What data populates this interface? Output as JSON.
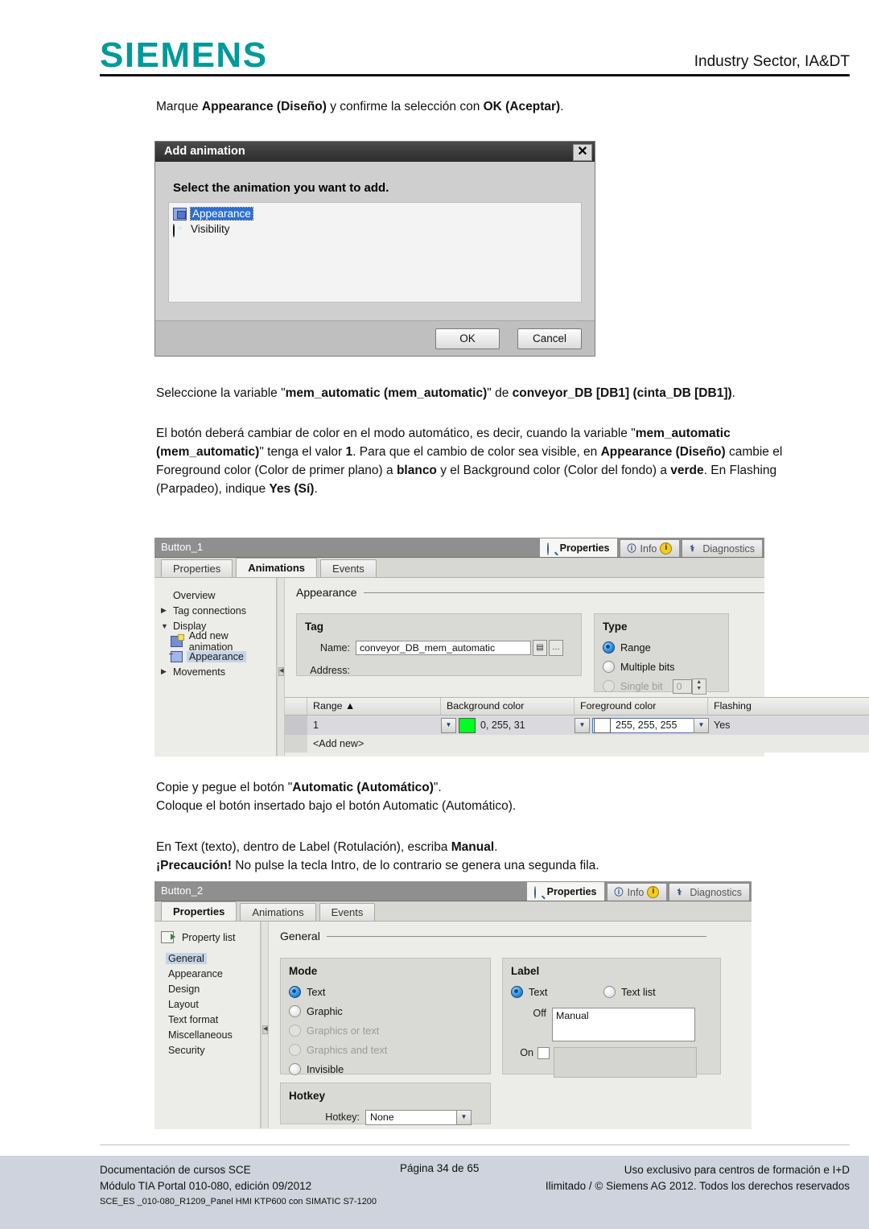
{
  "header": {
    "logo": "SIEMENS",
    "right_text": "Industry Sector, IA&DT"
  },
  "body": {
    "intro_pre": "Marque ",
    "intro_b1": "Appearance (Diseño)",
    "intro_mid": " y confirme la selección con ",
    "intro_b2": "OK (Aceptar)",
    "intro_end": ".",
    "select_pre": "Seleccione la variable \"",
    "select_b1": "mem_automatic (mem_automatic)",
    "select_mid": "\" de ",
    "select_b2": "conveyor_DB [DB1] (cinta_DB [DB1])",
    "select_end": ".",
    "desc_1": "El botón deberá cambiar de color en el modo automático, es decir, cuando la variable \"",
    "desc_b1": "mem_automatic (mem_automatic)",
    "desc_2": "\" tenga el valor ",
    "desc_b2": "1",
    "desc_3": ". Para que el cambio de color sea visible, en ",
    "desc_b3": "Appearance (Diseño)",
    "desc_4": " cambie el Foreground color (Color de primer plano) a ",
    "desc_b4": "blanco",
    "desc_5": " y el Background color (Color del fondo) a ",
    "desc_b5": "verde",
    "desc_6": ". En Flashing (Parpadeo), indique ",
    "desc_b6": "Yes (Sí)",
    "desc_7": ".",
    "copy_pre": "Copie y pegue el botón \"",
    "copy_b1": "Automatic (Automático)",
    "copy_end": "\".",
    "copy_line2": "Coloque el botón insertado bajo el botón Automatic (Automático).",
    "text_pre": "En Text (texto), dentro de Label (Rotulación), escriba ",
    "text_b1": "Manual",
    "text_end": ".",
    "caution_b": "¡Precaución!",
    "caution_rest": " No pulse la tecla Intro, de lo contrario se genera una segunda fila."
  },
  "dialog": {
    "title": "Add animation",
    "close_label": "✕",
    "prompt": "Select the animation you want to add.",
    "items": [
      {
        "label": "Appearance",
        "icon": "appearance-icon",
        "selected": true
      },
      {
        "label": "Visibility",
        "icon": "visibility-icon",
        "selected": false
      }
    ],
    "ok_label": "OK",
    "cancel_label": "Cancel"
  },
  "panel1": {
    "object_name": "Button_1",
    "top_tabs": [
      {
        "label": "Properties",
        "icon": "magnifier-icon",
        "active": true
      },
      {
        "label": "Info",
        "icon": "info-icon",
        "badge": "i",
        "active": false
      },
      {
        "label": "Diagnostics",
        "icon": "diagnostics-icon",
        "active": false
      }
    ],
    "sub_tabs": [
      {
        "label": "Properties",
        "active": false
      },
      {
        "label": "Animations",
        "active": true
      },
      {
        "label": "Events",
        "active": false
      }
    ],
    "tree": [
      {
        "label": "Overview",
        "arrow": "",
        "indent": 0,
        "icon": "",
        "selected": false
      },
      {
        "label": "Tag connections",
        "arrow": "▶",
        "indent": 0,
        "icon": "",
        "selected": false
      },
      {
        "label": "Display",
        "arrow": "▼",
        "indent": 0,
        "icon": "",
        "selected": false
      },
      {
        "label": "Add new animation",
        "arrow": "",
        "indent": 1,
        "icon": "add-animation-icon",
        "selected": false
      },
      {
        "label": "Appearance",
        "arrow": "",
        "indent": 1,
        "icon": "appearance-icon",
        "selected": true
      },
      {
        "label": "Movements",
        "arrow": "▶",
        "indent": 0,
        "icon": "",
        "selected": false
      }
    ],
    "section_title": "Appearance",
    "tag_group": {
      "title": "Tag",
      "name_label": "Name:",
      "name_value": "conveyor_DB_mem_automatic",
      "address_label": "Address:",
      "address_value": ""
    },
    "type_group": {
      "title": "Type",
      "options": [
        {
          "label": "Range",
          "selected": true,
          "disabled": false
        },
        {
          "label": "Multiple bits",
          "selected": false,
          "disabled": false
        },
        {
          "label": "Single bit",
          "selected": false,
          "disabled": true
        }
      ],
      "single_bit_value": "0"
    },
    "table": {
      "columns": [
        "Range ▲",
        "Background color",
        "Foreground color",
        "Flashing"
      ],
      "rows": [
        {
          "range": "1",
          "background_color_text": "0, 255, 31",
          "background_color_hex": "#00ff1f",
          "foreground_color_text": "255, 255, 255",
          "foreground_color_hex": "#ffffff",
          "flashing": "Yes"
        }
      ],
      "add_new": "<Add new>"
    }
  },
  "panel2": {
    "object_name": "Button_2",
    "top_tabs": [
      {
        "label": "Properties",
        "icon": "magnifier-icon",
        "active": true
      },
      {
        "label": "Info",
        "icon": "info-icon",
        "badge": "i",
        "active": false
      },
      {
        "label": "Diagnostics",
        "icon": "diagnostics-icon",
        "active": false
      }
    ],
    "sub_tabs": [
      {
        "label": "Properties",
        "active": true
      },
      {
        "label": "Animations",
        "active": false
      },
      {
        "label": "Events",
        "active": false
      }
    ],
    "property_list_label": "Property list",
    "tree": [
      {
        "label": "General",
        "selected": true
      },
      {
        "label": "Appearance",
        "selected": false
      },
      {
        "label": "Design",
        "selected": false
      },
      {
        "label": "Layout",
        "selected": false
      },
      {
        "label": "Text format",
        "selected": false
      },
      {
        "label": "Miscellaneous",
        "selected": false
      },
      {
        "label": "Security",
        "selected": false
      }
    ],
    "section_title": "General",
    "mode_group": {
      "title": "Mode",
      "options": [
        {
          "label": "Text",
          "selected": true,
          "disabled": false
        },
        {
          "label": "Graphic",
          "selected": false,
          "disabled": false
        },
        {
          "label": "Graphics or text",
          "selected": false,
          "disabled": true
        },
        {
          "label": "Graphics and text",
          "selected": false,
          "disabled": true
        },
        {
          "label": "Invisible",
          "selected": false,
          "disabled": false
        }
      ]
    },
    "label_group": {
      "title": "Label",
      "options": [
        {
          "label": "Text",
          "selected": true
        },
        {
          "label": "Text list",
          "selected": false
        }
      ],
      "off_label": "Off",
      "off_value": "Manual",
      "on_label": "On",
      "on_value": "",
      "on_checked": false
    },
    "hotkey_group": {
      "title": "Hotkey",
      "field_label": "Hotkey:",
      "value": "None"
    }
  },
  "footer": {
    "left_line1": "Documentación de cursos SCE",
    "left_line2": "Módulo TIA Portal 010-080, edición 09/2012",
    "center": "Página 34 de 65",
    "right_line1": "Uso exclusivo para centros de formación e I+D",
    "right_line2": "Ilimitado / © Siemens AG 2012. Todos los derechos reservados",
    "code": "SCE_ES _010-080_R1209_Panel HMI KTP600 con SIMATIC S7-1200"
  },
  "colors": {
    "brand_teal": "#009999",
    "footer_band": "#ced3dd",
    "green_swatch": "#00ff1f"
  }
}
